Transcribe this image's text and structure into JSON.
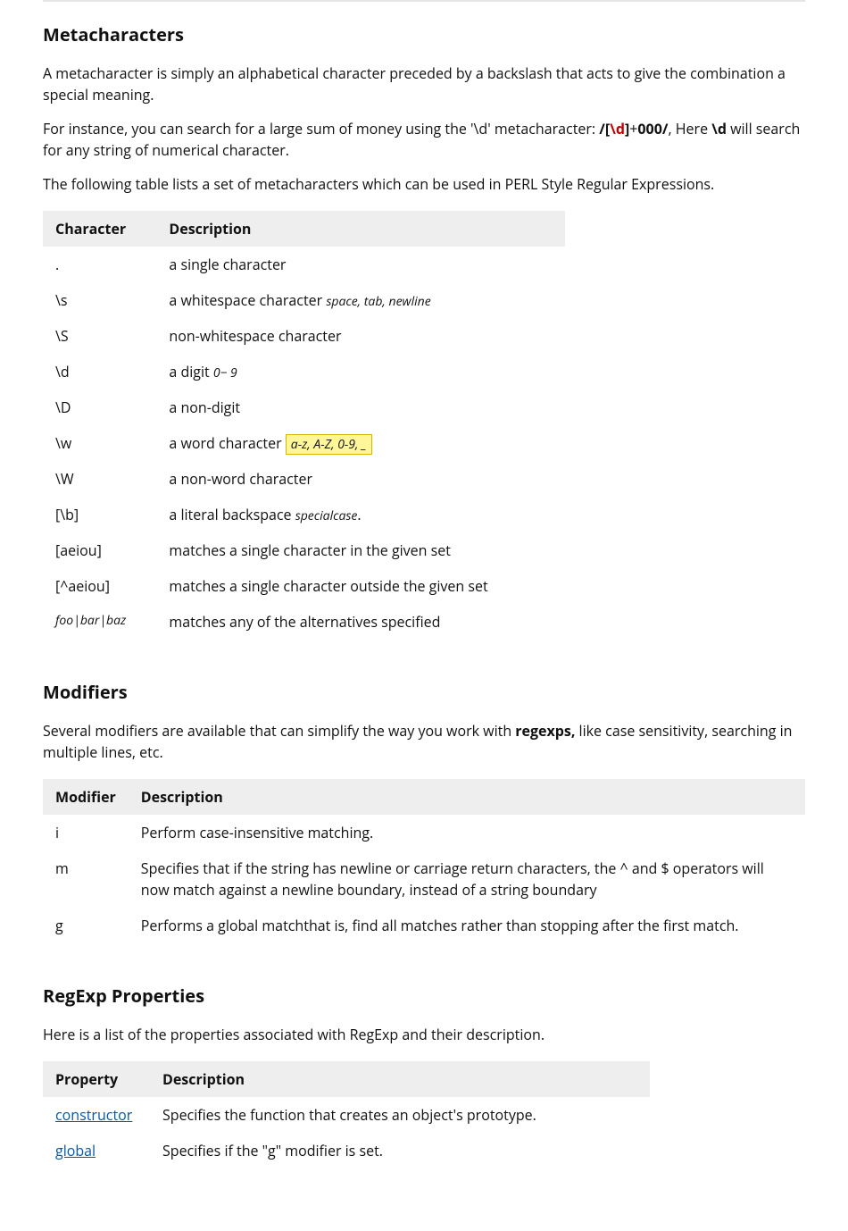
{
  "sections": {
    "meta": {
      "heading": "Metacharacters",
      "p1": "A metacharacter is simply an alphabetical character preceded by a backslash that acts to give the combination a special meaning.",
      "p2_lead": "For instance, you can search for a large sum of money using the '\\d' metacharacter: ",
      "p2_code_prefix": "/[",
      "p2_code_d": "\\d",
      "p2_code_suffix": "]",
      "p2_code_plus": "+",
      "p2_code_end": "000/",
      "p2_tail_pre": ", Here ",
      "p2_tail_bold": "\\d",
      "p2_tail_post": " will search for any string of numerical character.",
      "p3": "The following table lists a set of metacharacters which can be used in PERL Style Regular Expressions.",
      "th1": "Character",
      "th2": "Description",
      "rows": {
        "r0c0": ".",
        "r0c1": "a single character",
        "r1c0": "\\s",
        "r1c1a": "a whitespace character ",
        "r1c1b": "space, tab, newline",
        "r2c0": "\\S",
        "r2c1": "non-whitespace character",
        "r3c0": "\\d",
        "r3c1a": "a digit ",
        "r3c1b": "0− 9",
        "r4c0": "\\D",
        "r4c1": "a non-digit",
        "r5c0": "\\w",
        "r5c1a": "a word character ",
        "r5c1b": "a-z, A-Z, 0-9, _",
        "r6c0": "\\W",
        "r6c1": "a non-word character",
        "r7c0": "[\\b]",
        "r7c1a": "a literal backspace ",
        "r7c1b": "specialcase",
        "r7c1c": ".",
        "r8c0": "[aeiou]",
        "r8c1": "matches a single character in the given set",
        "r9c0": "[^aeiou]",
        "r9c1": "matches a single character outside the given set",
        "r10c0": "foo|bar|baz",
        "r10c1": "matches any of the alternatives specified"
      }
    },
    "mod": {
      "heading": "Modifiers",
      "p1a": "Several modifiers are available that can simplify the way you work with ",
      "p1b": "regexps,",
      "p1c": " like case sensitivity, searching in multiple lines, etc.",
      "th1": "Modifier",
      "th2": "Description",
      "rows": {
        "r0c0": "i",
        "r0c1": "Perform case-insensitive matching.",
        "r1c0": "m",
        "r1c1": "Specifies that if the string has newline or carriage return characters, the ^ and $ operators will now match against a newline boundary, instead of a string boundary",
        "r2c0": "g",
        "r2c1": "Performs a global matchthat is, find all matches rather than stopping after the first match."
      }
    },
    "prop": {
      "heading": "RegExp Properties",
      "p1": "Here is a list of the properties associated with RegExp and their description.",
      "th1": "Property",
      "th2": "Description",
      "rows": {
        "r0c0": "constructor",
        "r0c1": "Specifies the function that creates an object's prototype.",
        "r1c0": "global",
        "r1c1": "Specifies if the \"g\" modifier is set."
      }
    }
  }
}
